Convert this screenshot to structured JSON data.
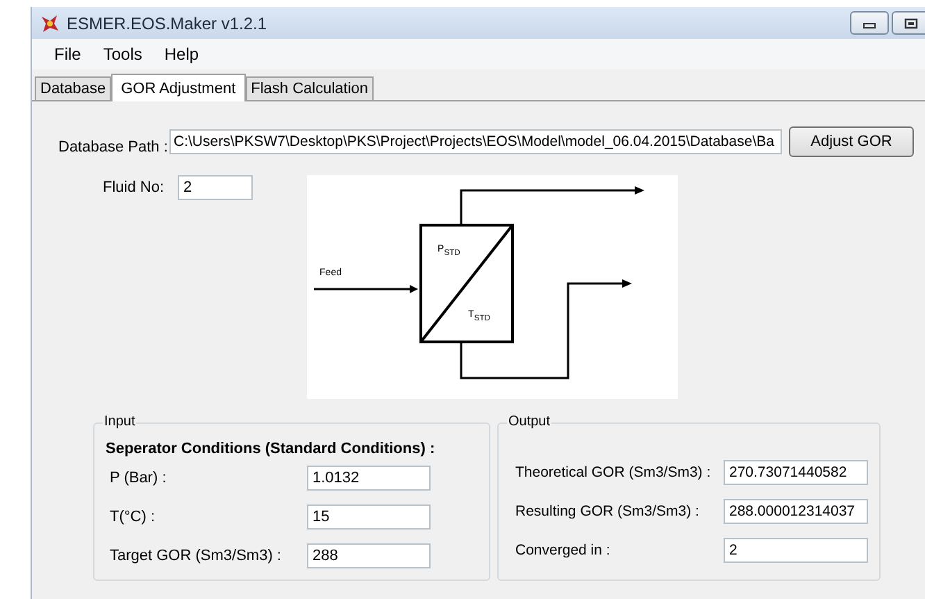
{
  "window": {
    "title": "ESMER.EOS.Maker v1.2.1"
  },
  "menu": [
    "File",
    "Tools",
    "Help"
  ],
  "tabs": [
    {
      "label": "Database",
      "selected": false
    },
    {
      "label": "GOR Adjustment",
      "selected": true
    },
    {
      "label": "Flash Calculation",
      "selected": false
    }
  ],
  "database_path": {
    "label": "Database Path :",
    "value": "C:\\Users\\PKSW7\\Desktop\\PKS\\Project\\Projects\\EOS\\Model\\model_06.04.2015\\Database\\Ba"
  },
  "adjust_button": "Adjust GOR",
  "fluid_no": {
    "label": "Fluid No:",
    "value": "2"
  },
  "diagram": {
    "feed_label": "Feed",
    "pressure_label": "P$_{STD}$",
    "temperature_label": "T$_{STD}$"
  },
  "input": {
    "title": "Input",
    "heading": "Seperator Conditions (Standard Conditions) :",
    "fields": [
      {
        "label": "P (Bar) :",
        "value": "1.0132"
      },
      {
        "label": "T(°C) :",
        "value": "15"
      },
      {
        "label": "Target GOR (Sm3/Sm3) :",
        "value": "288"
      }
    ]
  },
  "output": {
    "title": "Output",
    "fields": [
      {
        "label": "Theoretical GOR (Sm3/Sm3) :",
        "value": "270.73071440582"
      },
      {
        "label": "Resulting GOR (Sm3/Sm3) :",
        "value": "288.000012314037"
      },
      {
        "label": "Converged in :",
        "value": "2"
      }
    ]
  }
}
